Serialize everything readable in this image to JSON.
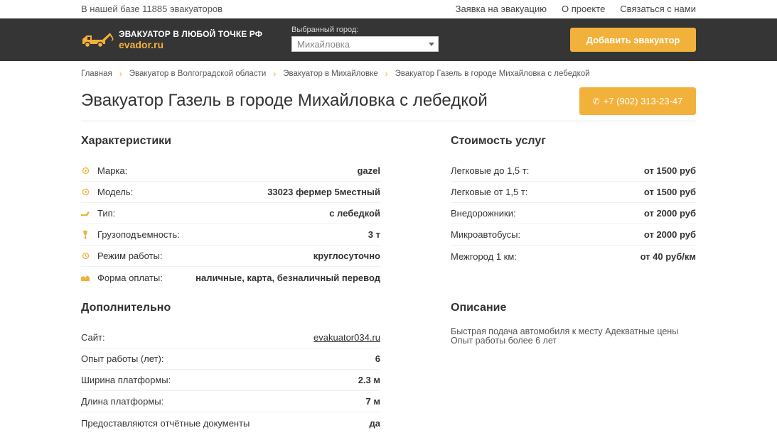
{
  "topbar": {
    "count_text": "В нашей базе 11885 эвакуаторов",
    "links": [
      "Заявка на эвакуацию",
      "О проекте",
      "Связаться с нами"
    ]
  },
  "header": {
    "logo_line1": "ЭВАКУАТОР В ЛЮБОЙ ТОЧКЕ РФ",
    "logo_line2": "evador.ru",
    "city_label": "Выбранный город:",
    "city_value": "Михайловка",
    "add_button": "Добавить эвакуатор"
  },
  "breadcrumb": [
    "Главная",
    "Эвакуатор в Волгоградской области",
    "Эвакуатор в Михайловке",
    "Эвакуатор Газель в городе Михайловка с лебедкой"
  ],
  "title": "Эвакуатор Газель в городе Михайловка с лебедкой",
  "phone_button": "+7 (902) 313-23-47",
  "specs": {
    "title": "Характеристики",
    "rows": [
      {
        "icon": "gear-icon",
        "label": "Марка:",
        "value": "gazel"
      },
      {
        "icon": "gear-icon",
        "label": "Модель:",
        "value": "33023 фермер 5местный"
      },
      {
        "icon": "winch-icon",
        "label": "Тип:",
        "value": "с лебедкой"
      },
      {
        "icon": "weight-icon",
        "label": "Грузоподъемность:",
        "value": "3 т"
      },
      {
        "icon": "clock-icon",
        "label": "Режим работы:",
        "value": "круглосуточно"
      },
      {
        "icon": "wallet-icon",
        "label": "Форма оплаты:",
        "value": "наличные, карта, безналичный перевод"
      }
    ]
  },
  "prices": {
    "title": "Стоимость услуг",
    "rows": [
      {
        "label": "Легковые до 1,5 т:",
        "value": "от 1500 руб"
      },
      {
        "label": "Легковые от 1,5 т:",
        "value": "от 1500 руб"
      },
      {
        "label": "Внедорожники:",
        "value": "от 2000 руб"
      },
      {
        "label": "Микроавтобусы:",
        "value": "от 2000 руб"
      },
      {
        "label": "Межгород 1 км:",
        "value": "от 40 руб/км"
      }
    ]
  },
  "extra": {
    "title": "Дополнительно",
    "rows": [
      {
        "label": "Сайт:",
        "value": "evakuator034.ru"
      },
      {
        "label": "Опыт работы (лет):",
        "value": "6"
      },
      {
        "label": "Ширина платформы:",
        "value": "2.3 м"
      },
      {
        "label": "Длина платформы:",
        "value": "7 м"
      },
      {
        "label": "Предоставляются отчётные документы",
        "value": "да"
      }
    ]
  },
  "description": {
    "title": "Описание",
    "text": "Быстрая подача автомобиля к месту Адекватные цены Опыт работы более 6 лет"
  },
  "colors": {
    "accent": "#f2b13a",
    "header_bg": "#353535",
    "link": "#4a5aa0"
  }
}
